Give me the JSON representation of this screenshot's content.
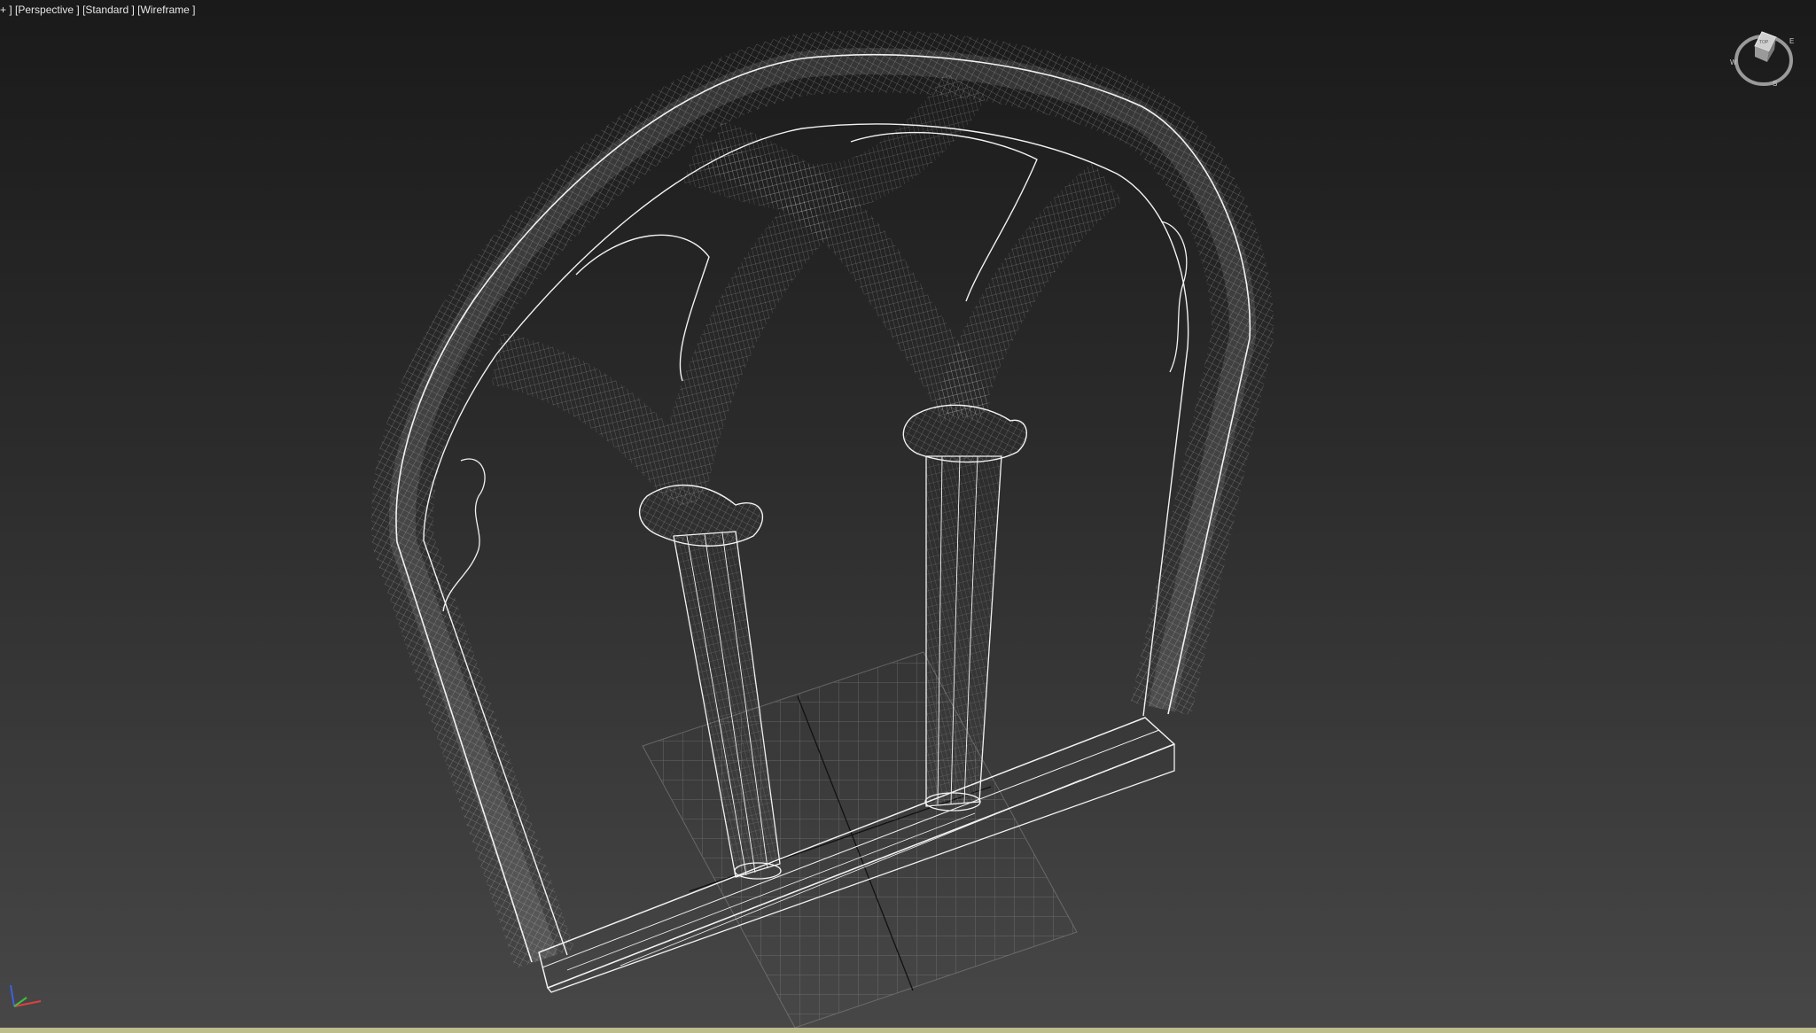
{
  "viewport": {
    "label": {
      "menu": "+ ]",
      "view": "[Perspective ]",
      "shading_style": "[Standard ]",
      "display_mode": "[Wireframe ]"
    },
    "background_colors": {
      "top": "#1a1a1a",
      "bottom": "#474747"
    },
    "wireframe_color": "#f2f2f2",
    "grid_color": "#8a8a8a",
    "active_border_color": "#bdbd8c"
  },
  "scene": {
    "object": "gothic-window-arch",
    "style": "wireframe"
  },
  "viewcube": {
    "icon": "viewcube-icon",
    "face_label": "TOP",
    "compass": {
      "north": "N",
      "east": "E",
      "south": "S",
      "west": "W"
    }
  },
  "axis_tripod": {
    "icon": "axis-tripod-icon",
    "colors": {
      "x": "#e04040",
      "y": "#40c040",
      "z": "#4060e0"
    }
  }
}
